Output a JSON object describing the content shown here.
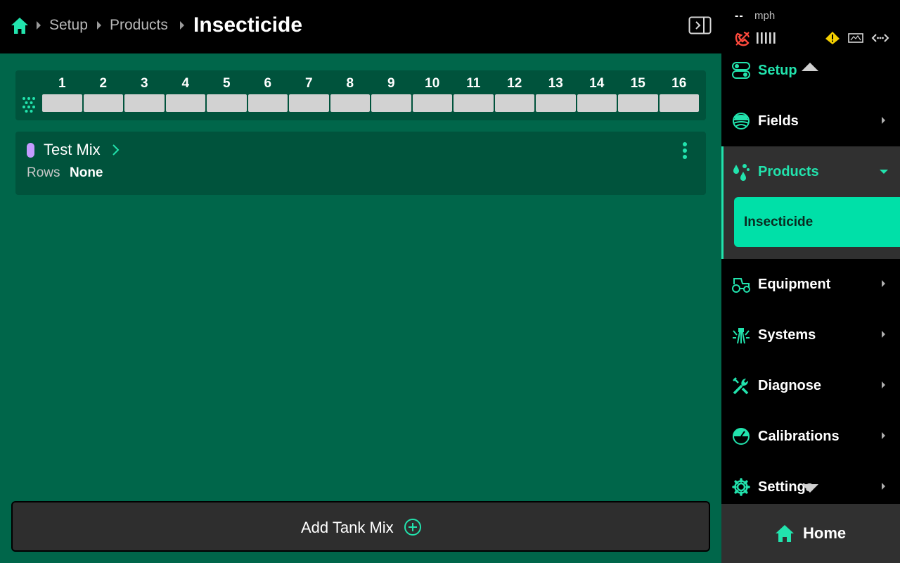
{
  "header": {
    "breadcrumbs": [
      "Setup",
      "Products"
    ],
    "current": "Insecticide"
  },
  "rows": {
    "labels": [
      "1",
      "2",
      "3",
      "4",
      "5",
      "6",
      "7",
      "8",
      "9",
      "10",
      "11",
      "12",
      "13",
      "14",
      "15",
      "16"
    ]
  },
  "tank_mix": {
    "name": "Test Mix",
    "rows_label": "Rows",
    "rows_value": "None",
    "chip_color": "#c49bff"
  },
  "add_button": {
    "label": "Add Tank Mix"
  },
  "status": {
    "speed_value": "--",
    "speed_unit": "mph"
  },
  "sidebar": {
    "setup_label": "Setup",
    "items": [
      {
        "label": "Fields",
        "icon": "fields-icon"
      },
      {
        "label": "Products",
        "icon": "products-icon"
      },
      {
        "label": "Equipment",
        "icon": "tractor-icon"
      },
      {
        "label": "Systems",
        "icon": "systems-icon"
      },
      {
        "label": "Diagnose",
        "icon": "wrench-icon"
      },
      {
        "label": "Calibrations",
        "icon": "gauge-icon"
      },
      {
        "label": "Settings",
        "icon": "gear-icon"
      }
    ],
    "sub_item": "Insecticide",
    "home_label": "Home"
  },
  "colors": {
    "accent": "#22e3ad",
    "main_bg": "#00664a",
    "card_bg": "#00533c",
    "selected_bg": "#00e0a8"
  }
}
